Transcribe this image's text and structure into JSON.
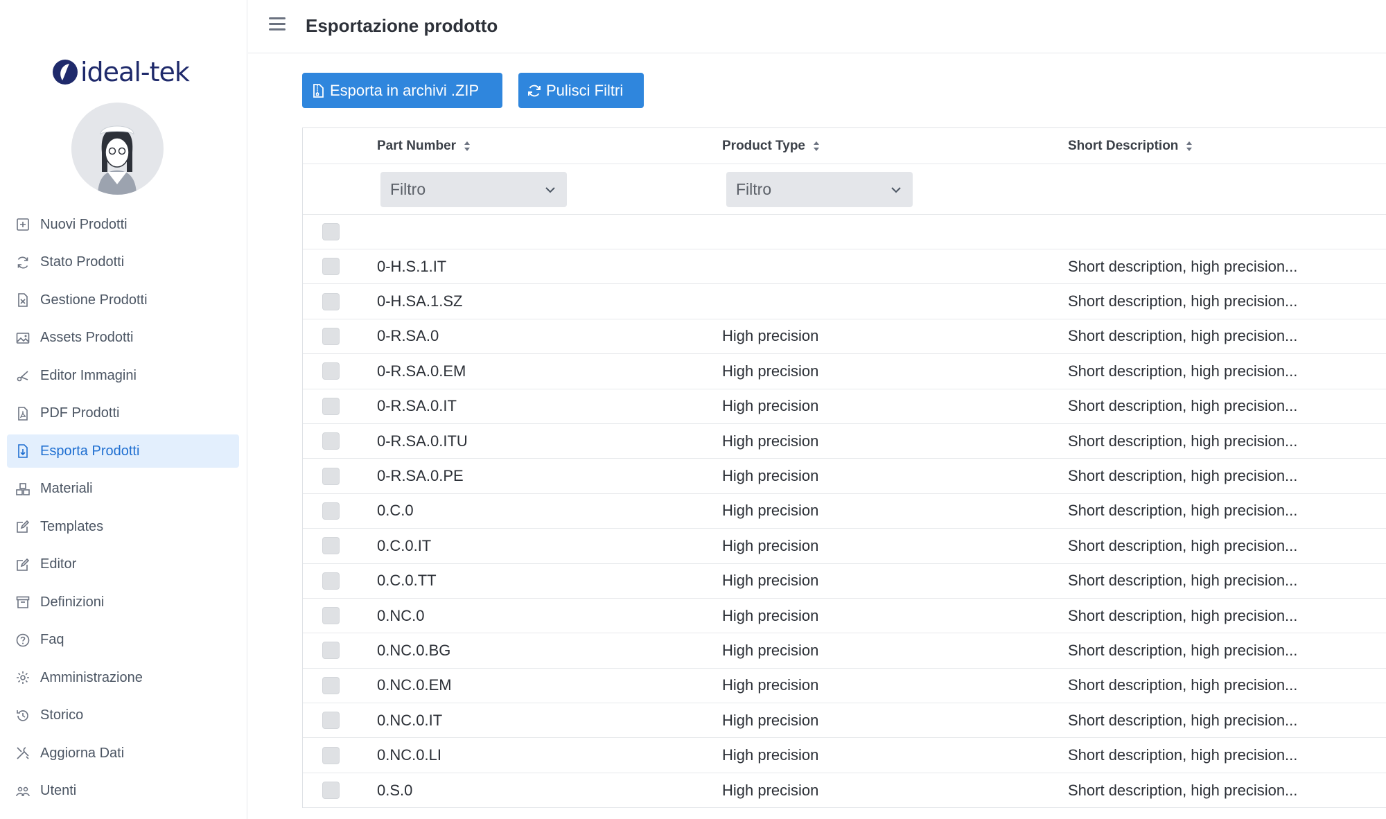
{
  "brand": {
    "logo_text": "ideal-tek"
  },
  "sidebar": {
    "items": [
      {
        "label": "Nuovi Prodotti",
        "icon": "plus-square-icon"
      },
      {
        "label": "Stato Prodotti",
        "icon": "refresh-icon"
      },
      {
        "label": "Gestione Prodotti",
        "icon": "file-excel-icon"
      },
      {
        "label": "Assets Prodotti",
        "icon": "image-icon"
      },
      {
        "label": "Editor Immagini",
        "icon": "scissors-icon"
      },
      {
        "label": "PDF Prodotti",
        "icon": "file-pdf-icon"
      },
      {
        "label": "Esporta Prodotti",
        "icon": "file-export-icon",
        "active": true
      },
      {
        "label": "Materiali",
        "icon": "boxes-icon"
      },
      {
        "label": "Templates",
        "icon": "edit-icon"
      },
      {
        "label": "Editor",
        "icon": "edit-icon"
      },
      {
        "label": "Definizioni",
        "icon": "archive-icon"
      },
      {
        "label": "Faq",
        "icon": "question-circle-icon"
      },
      {
        "label": "Amministrazione",
        "icon": "gear-icon"
      },
      {
        "label": "Storico",
        "icon": "history-icon"
      },
      {
        "label": "Aggiorna Dati",
        "icon": "tools-icon"
      },
      {
        "label": "Utenti",
        "icon": "users-icon"
      }
    ]
  },
  "header": {
    "title": "Esportazione prodotto"
  },
  "toolbar": {
    "export_label": "Esporta in archivi .ZIP",
    "clear_label": "Pulisci Filtri"
  },
  "table": {
    "columns": [
      "Part Number",
      "Product Type",
      "Short Description"
    ],
    "filters": {
      "part_number": "Filtro",
      "product_type": "Filtro"
    },
    "rows": [
      {
        "part": "0-H.S.1.IT",
        "type": "",
        "desc": "Short description, high precision..."
      },
      {
        "part": "0-H.SA.1.SZ",
        "type": "",
        "desc": "Short description, high precision..."
      },
      {
        "part": "0-R.SA.0",
        "type": "High precision",
        "desc": "Short description, high precision..."
      },
      {
        "part": "0-R.SA.0.EM",
        "type": "High precision",
        "desc": "Short description, high precision..."
      },
      {
        "part": "0-R.SA.0.IT",
        "type": "High precision",
        "desc": "Short description, high precision..."
      },
      {
        "part": "0-R.SA.0.ITU",
        "type": "High precision",
        "desc": "Short description, high precision..."
      },
      {
        "part": "0-R.SA.0.PE",
        "type": "High precision",
        "desc": "Short description, high precision..."
      },
      {
        "part": "0.C.0",
        "type": "High precision",
        "desc": "Short description, high precision..."
      },
      {
        "part": "0.C.0.IT",
        "type": "High precision",
        "desc": "Short description, high precision..."
      },
      {
        "part": "0.C.0.TT",
        "type": "High precision",
        "desc": "Short description, high precision..."
      },
      {
        "part": "0.NC.0",
        "type": "High precision",
        "desc": "Short description, high precision..."
      },
      {
        "part": "0.NC.0.BG",
        "type": "High precision",
        "desc": "Short description, high precision..."
      },
      {
        "part": "0.NC.0.EM",
        "type": "High precision",
        "desc": "Short description, high precision..."
      },
      {
        "part": "0.NC.0.IT",
        "type": "High precision",
        "desc": "Short description, high precision..."
      },
      {
        "part": "0.NC.0.LI",
        "type": "High precision",
        "desc": "Short description, high precision..."
      },
      {
        "part": "0.S.0",
        "type": "High precision",
        "desc": "Short description, high precision..."
      }
    ]
  },
  "colors": {
    "accent": "#2f86dd",
    "active_bg": "#e3effd",
    "active_text": "#1f6fd1"
  }
}
